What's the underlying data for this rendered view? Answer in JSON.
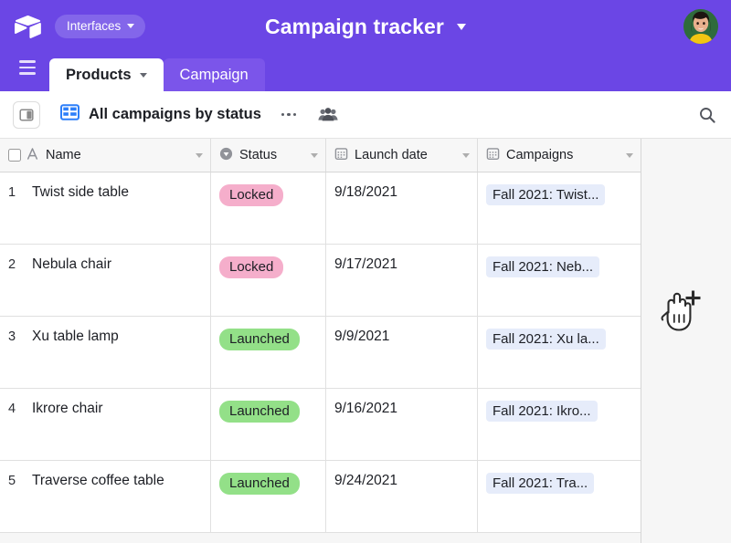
{
  "header": {
    "logo_icon": "airtable-logo-icon",
    "interfaces_label": "Interfaces",
    "app_title": "Campaign tracker",
    "title_caret_icon": "chevron-down-icon",
    "avatar_icon": "user-avatar",
    "brand_color": "#6b46e5",
    "pill_color": "#8366ea"
  },
  "tabs": {
    "menu_icon": "hamburger-menu-icon",
    "items": [
      {
        "label": "Products",
        "active": true,
        "has_caret": true
      },
      {
        "label": "Campaign",
        "active": false,
        "has_caret": false
      }
    ]
  },
  "toolbar": {
    "panel_toggle_icon": "sidebar-toggle-icon",
    "view_icon": "grid-view-icon",
    "view_name": "All campaigns by status",
    "more_icon": "more-options-icon",
    "collaborators_icon": "people-icon",
    "search_icon": "search-icon"
  },
  "grid": {
    "columns": [
      {
        "label": "Name",
        "icon": "text-field-icon",
        "has_checkbox": true
      },
      {
        "label": "Status",
        "icon": "single-select-icon",
        "has_checkbox": false
      },
      {
        "label": "Launch date",
        "icon": "date-field-icon",
        "has_checkbox": false
      },
      {
        "label": "Campaigns",
        "icon": "linked-record-icon",
        "has_checkbox": false
      }
    ],
    "add_field_icon": "plus-icon",
    "cursor_icon": "hand-pointer-add-cursor",
    "rows": [
      {
        "num": "1",
        "name": "Twist side table",
        "status": "Locked",
        "status_type": "locked",
        "date": "9/18/2021",
        "campaign": "Fall 2021: Twist..."
      },
      {
        "num": "2",
        "name": "Nebula chair",
        "status": "Locked",
        "status_type": "locked",
        "date": "9/17/2021",
        "campaign": "Fall 2021: Neb..."
      },
      {
        "num": "3",
        "name": "Xu table lamp",
        "status": "Launched",
        "status_type": "launched",
        "date": "9/9/2021",
        "campaign": "Fall 2021: Xu la..."
      },
      {
        "num": "4",
        "name": "Ikrore chair",
        "status": "Launched",
        "status_type": "launched",
        "date": "9/16/2021",
        "campaign": "Fall 2021: Ikro..."
      },
      {
        "num": "5",
        "name": "Traverse coffee table",
        "status": "Launched",
        "status_type": "launched",
        "date": "9/24/2021",
        "campaign": "Fall 2021: Tra..."
      }
    ],
    "colors": {
      "locked_pill": "#f5aecb",
      "launched_pill": "#93e088",
      "link_chip": "#e6ecfa"
    }
  }
}
